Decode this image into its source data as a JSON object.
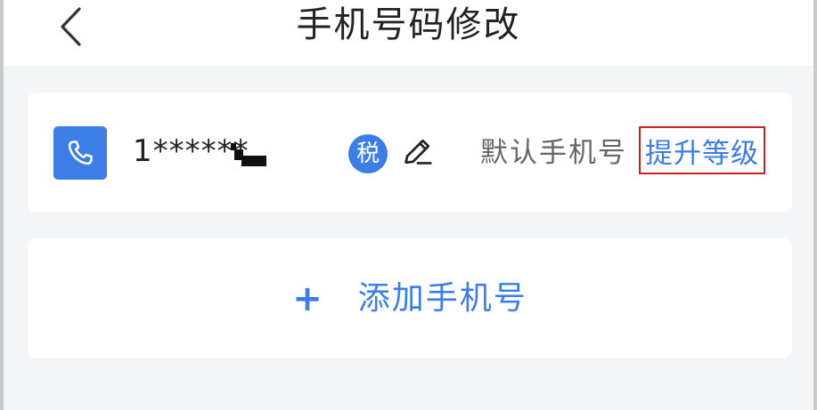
{
  "header": {
    "title": "手机号码修改",
    "back_icon": "chevron-left-icon"
  },
  "phone_card": {
    "icon": "phone-icon",
    "number_masked": "1******",
    "tax_badge": "税",
    "edit_icon": "edit-pencil-icon",
    "default_label": "默认手机号",
    "upgrade_link": "提升等级"
  },
  "add_card": {
    "plus": "+",
    "label": "添加手机号"
  },
  "colors": {
    "accent": "#3d7ee6",
    "highlight_border": "#cc2222",
    "background": "#f4f5f7"
  }
}
